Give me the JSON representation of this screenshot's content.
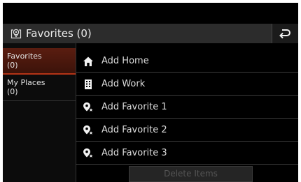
{
  "header": {
    "title": "Favorites (0)",
    "pin_icon": "map-pin-icon",
    "back_icon": "back-arrow-icon"
  },
  "sidebar": {
    "items": [
      {
        "label": "Favorites\n(0)",
        "selected": true
      },
      {
        "label": "My Places\n(0)",
        "selected": false
      }
    ]
  },
  "list": {
    "items": [
      {
        "label": "Add Home",
        "icon": "home-icon"
      },
      {
        "label": "Add Work",
        "icon": "building-icon"
      },
      {
        "label": "Add Favorite 1",
        "icon": "favorite-pin-icon"
      },
      {
        "label": "Add Favorite 2",
        "icon": "favorite-pin-icon"
      },
      {
        "label": "Add Favorite 3",
        "icon": "favorite-pin-icon"
      }
    ]
  },
  "footer": {
    "delete_label": "Delete Items",
    "delete_enabled": false
  },
  "colors": {
    "accent": "#b53416",
    "background": "#000000",
    "header": "#2c2c2c"
  }
}
